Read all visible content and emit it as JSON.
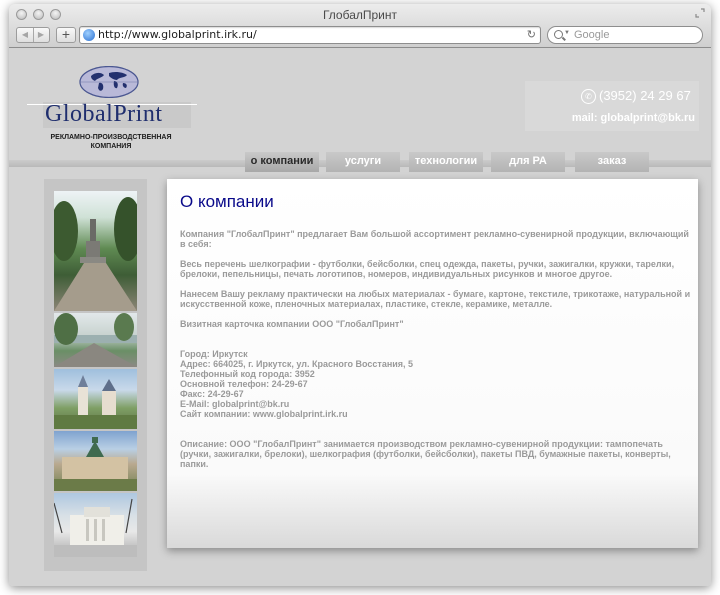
{
  "window": {
    "title": "ГлобалПринт"
  },
  "toolbar": {
    "url": "http://www.globalprint.irk.ru/",
    "search_placeholder": "Google",
    "back_icon": "back-arrow-icon",
    "forward_icon": "forward-arrow-icon",
    "add_label": "+"
  },
  "header": {
    "logo_word": "GlobalPrint",
    "logo_sub_line1": "РЕКЛАМНО-ПРОИЗВОДСТВЕННАЯ",
    "logo_sub_line2": "КОМПАНИЯ",
    "phone": "(3952) 24 29 67",
    "mail": "mail: globalprint@bk.ru"
  },
  "nav": {
    "items": [
      {
        "label": "о компании",
        "active": true
      },
      {
        "label": "услуги",
        "active": false
      },
      {
        "label": "технологии",
        "active": false
      },
      {
        "label": "для РА",
        "active": false
      },
      {
        "label": "заказ",
        "active": false
      }
    ]
  },
  "content": {
    "title": "О компании",
    "p1": "Компания \"ГлобалПринт\" предлагает Вам большой ассортимент рекламно-сувенирной продукции, включающий в себя:",
    "p2": "Весь перечень шелкографии - футболки, бейсболки, спец одежда, пакеты, ручки, зажигалки, кружки, тарелки, брелоки, пепельницы, печать логотипов, номеров, индивидуальных рисунков и многое другое.",
    "p3": "Нанесем Вашу рекламу практически на любых материалах - бумаге, картоне, текстиле, трикотаже, натуральной и искусственной коже, пленочных материалах, пластике, стекле, керамике, металле.",
    "card_title": "Визитная карточка компании ООО \"ГлобалПринт\"",
    "city": "Город: Иркутск",
    "address": "Адрес: 664025, г. Иркутск, ул. Красного Восстания, 5",
    "phone_code": "Телефонный код города: 3952",
    "main_phone": "Основной телефон: 24-29-67",
    "fax": "Факс: 24-29-67",
    "email": "E-Mail: globalprint@bk.ru",
    "site": "Сайт компании: www.globalprint.irk.ru",
    "description": "Описание: ООО \"ГлобалПринт\" занимается производством рекламно-сувенирной продукции: тампопечать (ручки, зажигалки, брелоки), шелкография (футболки, бейсболки), пакеты ПВД, бумажные пакеты, конверты, папки."
  }
}
